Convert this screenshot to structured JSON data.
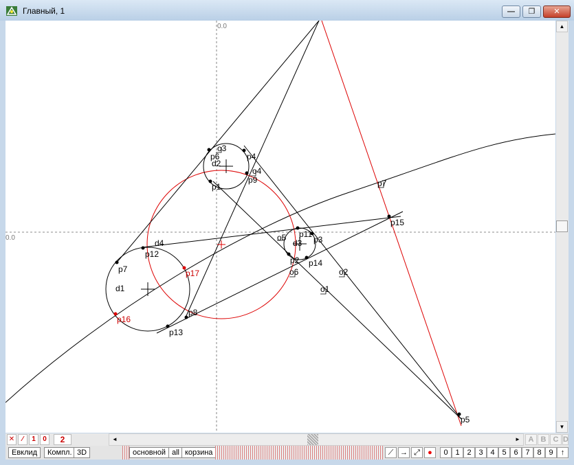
{
  "window": {
    "title": "Главный, 1",
    "min_glyph": "—",
    "max_glyph": "❐",
    "close_glyph": "✕"
  },
  "axes": {
    "x_label": "0.0",
    "y_label": "0.0"
  },
  "labels": [
    {
      "text": "p6",
      "color": "#000"
    },
    {
      "text": "o3",
      "color": "#000"
    },
    {
      "text": "d2",
      "color": "#000"
    },
    {
      "text": "p4",
      "color": "#000"
    },
    {
      "text": "o4",
      "color": "#000"
    },
    {
      "text": "p9",
      "color": "#000"
    },
    {
      "text": "p1",
      "color": "#000"
    },
    {
      "text": "p7",
      "color": "#000"
    },
    {
      "text": "p15",
      "color": "#000"
    },
    {
      "text": "d4",
      "color": "#000"
    },
    {
      "text": "p12",
      "color": "#000"
    },
    {
      "text": "o5",
      "color": "#000"
    },
    {
      "text": "d3",
      "color": "#000"
    },
    {
      "text": "p11",
      "color": "#000"
    },
    {
      "text": "p3",
      "color": "#000"
    },
    {
      "text": "p2",
      "color": "#000"
    },
    {
      "text": "p14",
      "color": "#000"
    },
    {
      "text": "p7",
      "color": "#000"
    },
    {
      "text": "p17",
      "color": "#c00"
    },
    {
      "text": "o6",
      "color": "#000"
    },
    {
      "text": "o2",
      "color": "#000"
    },
    {
      "text": "d1",
      "color": "#000"
    },
    {
      "text": "o1",
      "color": "#000"
    },
    {
      "text": "p16",
      "color": "#c00"
    },
    {
      "text": "p8",
      "color": "#000"
    },
    {
      "text": "p13",
      "color": "#000"
    },
    {
      "text": "p5",
      "color": "#000"
    }
  ],
  "toolbar_left": {
    "x_btn": "✕",
    "slash_btn": "⁄",
    "one_btn": "1",
    "zero_btn": "0",
    "two_btn": "2"
  },
  "scroll": {
    "left_arrow": "◄",
    "right_arrow": "►",
    "up_arrow": "▲",
    "down_arrow": "▼"
  },
  "letters": [
    "A",
    "B",
    "C",
    "D"
  ],
  "tabs_left": [
    "Евклид",
    "Компл.",
    "3D"
  ],
  "tabs_center": [
    "основной",
    "all",
    "корзина"
  ],
  "tools": {
    "line": "⟋",
    "arrow": "→",
    "diag": "⤢",
    "record": "●"
  },
  "digits": [
    "0",
    "1",
    "2",
    "3",
    "4",
    "5",
    "6",
    "7",
    "8",
    "9",
    "↑"
  ]
}
